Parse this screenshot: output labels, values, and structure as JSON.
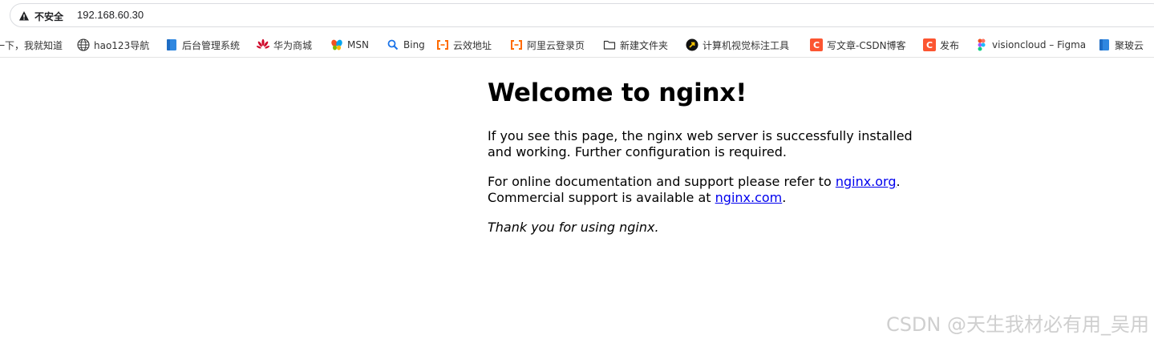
{
  "address_bar": {
    "security_label": "不安全",
    "url": "192.168.60.30"
  },
  "bookmarks": [
    {
      "label": "一下，我就知道",
      "icon": "none"
    },
    {
      "label": "hao123导航",
      "icon": "globe-icon"
    },
    {
      "label": "后台管理系统",
      "icon": "blue-page-icon"
    },
    {
      "label": "华为商城",
      "icon": "huawei-logo-icon"
    },
    {
      "label": "MSN",
      "icon": "msn-butterfly-icon"
    },
    {
      "label": "Bing",
      "icon": "search-icon"
    },
    {
      "label": "云效地址",
      "icon": "aliyun-icon"
    },
    {
      "label": "阿里云登录页",
      "icon": "aliyun-icon"
    },
    {
      "label": "新建文件夹",
      "icon": "folder-icon"
    },
    {
      "label": "计算机视觉标注工具",
      "icon": "arrow-circle-icon"
    },
    {
      "label": "写文章-CSDN博客",
      "icon": "csdn-icon"
    },
    {
      "label": "发布",
      "icon": "csdn-icon"
    },
    {
      "label": "visioncloud – Figma",
      "icon": "figma-icon"
    },
    {
      "label": "聚玻云",
      "icon": "blue-page-icon"
    }
  ],
  "page": {
    "heading": "Welcome to nginx!",
    "paragraph1": "If you see this page, the nginx web server is successfully installed and working. Further configuration is required.",
    "paragraph2_prefix": "For online documentation and support please refer to ",
    "link1": "nginx.org",
    "paragraph2_mid": ".",
    "paragraph2_line2": "Commercial support is available at ",
    "link2": "nginx.com",
    "paragraph2_end": ".",
    "paragraph3": "Thank you for using nginx."
  },
  "watermark": "CSDN @天生我材必有用_吴用",
  "colors": {
    "link": "#0000ee",
    "csdn_red": "#fc5531",
    "aliyun_orange": "#ff6a00",
    "bookmark_blue": "#2f87e0",
    "huawei_red": "#cf0a2c"
  }
}
